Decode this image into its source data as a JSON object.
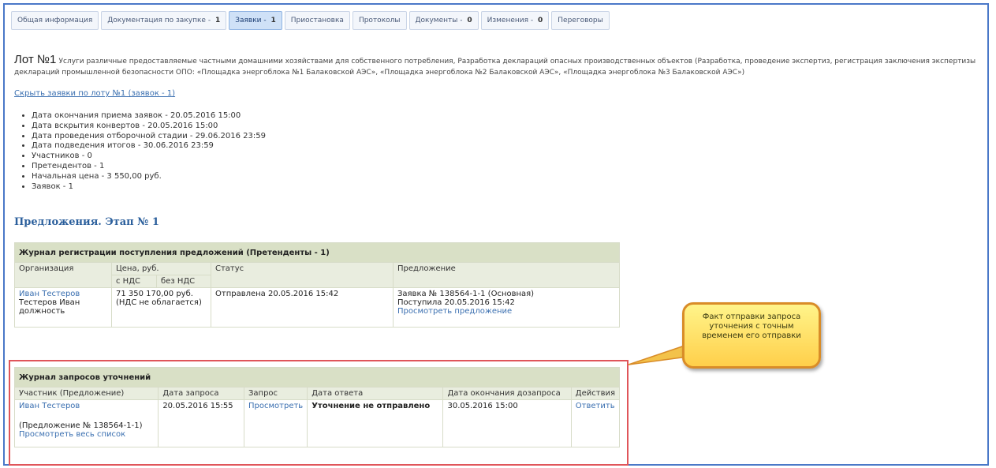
{
  "tabs": [
    {
      "label": "Общая информация",
      "count": ""
    },
    {
      "label": "Документация по закупке",
      "count": "1"
    },
    {
      "label": "Заявки",
      "count": "1"
    },
    {
      "label": "Приостановка",
      "count": ""
    },
    {
      "label": "Протоколы",
      "count": ""
    },
    {
      "label": "Документы",
      "count": "0"
    },
    {
      "label": "Изменения",
      "count": "0"
    },
    {
      "label": "Переговоры",
      "count": ""
    }
  ],
  "lot": {
    "title": "Лот №1",
    "description": "Услуги различные предоставляемые частными домашними хозяйствами для собственного потребления, Разработка деклараций опасных производственных объектов (Разработка, проведение экспертиз, регистрация заключения экспертизы деклараций промышленной безопасности ОПО: «Площадка энергоблока №1 Балаковской АЭС», «Площадка энергоблока №2 Балаковской АЭС», «Площадка энергоблока №3 Балаковской АЭС»)",
    "hide_link": "Скрыть заявки по лоту №1 (заявок - 1)"
  },
  "facts": [
    "Дата окончания приема заявок - 20.05.2016 15:00",
    "Дата вскрытия конвертов - 20.05.2016 15:00",
    "Дата проведения отборочной стадии - 29.06.2016 23:59",
    "Дата подведения итогов - 30.06.2016 23:59",
    "Участников - 0",
    "Претендентов - 1",
    "Начальная цена - 3 550,00 руб.",
    "Заявок - 1"
  ],
  "section_title": "Предложения. Этап № 1",
  "reg_journal": {
    "caption": "Журнал регистрации поступления предложений (Претенденты - 1)",
    "headers": {
      "org": "Организация",
      "price": "Цена, руб.",
      "with_vat": "с НДС",
      "without_vat": "без НДС",
      "status": "Статус",
      "offer": "Предложение"
    },
    "row": {
      "org_link": "Иван Тестеров",
      "org_name": "Тестеров Иван",
      "org_position": "должность",
      "price_value": "71 350 170,00 руб.",
      "price_note": "(НДС не облагается)",
      "status": "Отправлена 20.05.2016 15:42",
      "offer_line1": "Заявка № 138564-1-1 (Основная)",
      "offer_line2": "Поступила 20.05.2016 15:42",
      "offer_link": "Просмотреть предложение"
    }
  },
  "clar_journal": {
    "caption": "Журнал запросов уточнений",
    "headers": {
      "participant": "Участник (Предложение)",
      "request_date": "Дата запроса",
      "request": "Запрос",
      "answer_date": "Дата ответа",
      "end_date": "Дата окончания дозапроса",
      "actions": "Действия"
    },
    "row": {
      "participant_link": "Иван Тестеров",
      "participant_offer": "(Предложение № 138564-1-1)",
      "view_all_link": "Просмотреть весь список",
      "request_date": "20.05.2016 15:55",
      "request_link": "Просмотреть",
      "answer": "Уточнение не отправлено",
      "end_date": "30.05.2016 15:00",
      "action_link": "Ответить"
    }
  },
  "callout": {
    "text": "Факт отправки запроса уточнения с точным временем его отправки"
  },
  "colors": {
    "accent": "#3a6fb0",
    "table_header": "#d9e0c6",
    "callout_border": "#d98c28",
    "highlight_border": "#e0555a"
  }
}
